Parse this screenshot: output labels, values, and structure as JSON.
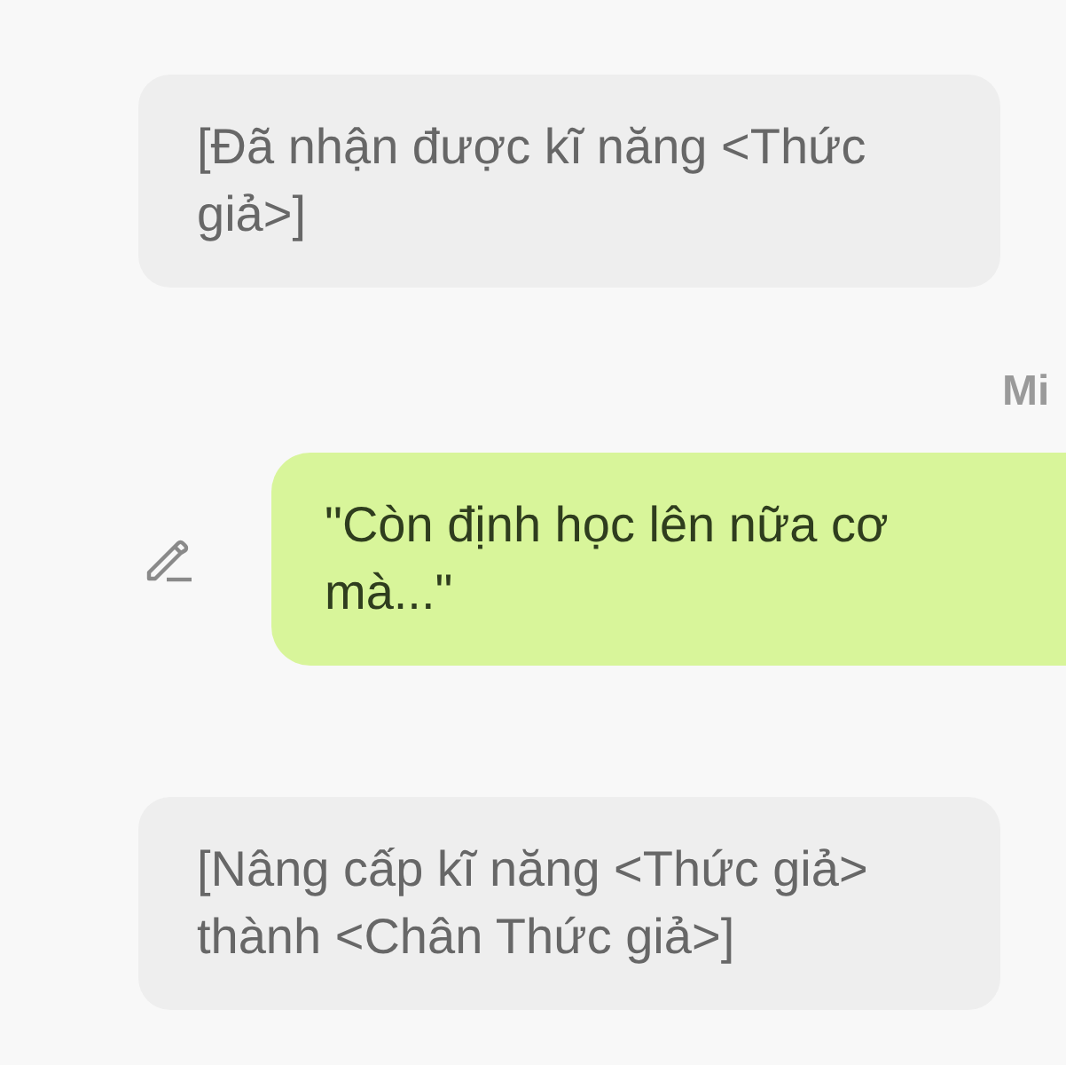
{
  "messages": [
    {
      "kind": "system",
      "text": "[Đã nhận được kĩ năng <Thức giả>]"
    },
    {
      "kind": "outgoing",
      "sender": "Mi",
      "editable": true,
      "text": "\"Còn định học lên nữa cơ mà...\""
    },
    {
      "kind": "system",
      "text": "[Nâng cấp kĩ năng <Thức giả> thành <Chân Thức giả>]"
    }
  ]
}
